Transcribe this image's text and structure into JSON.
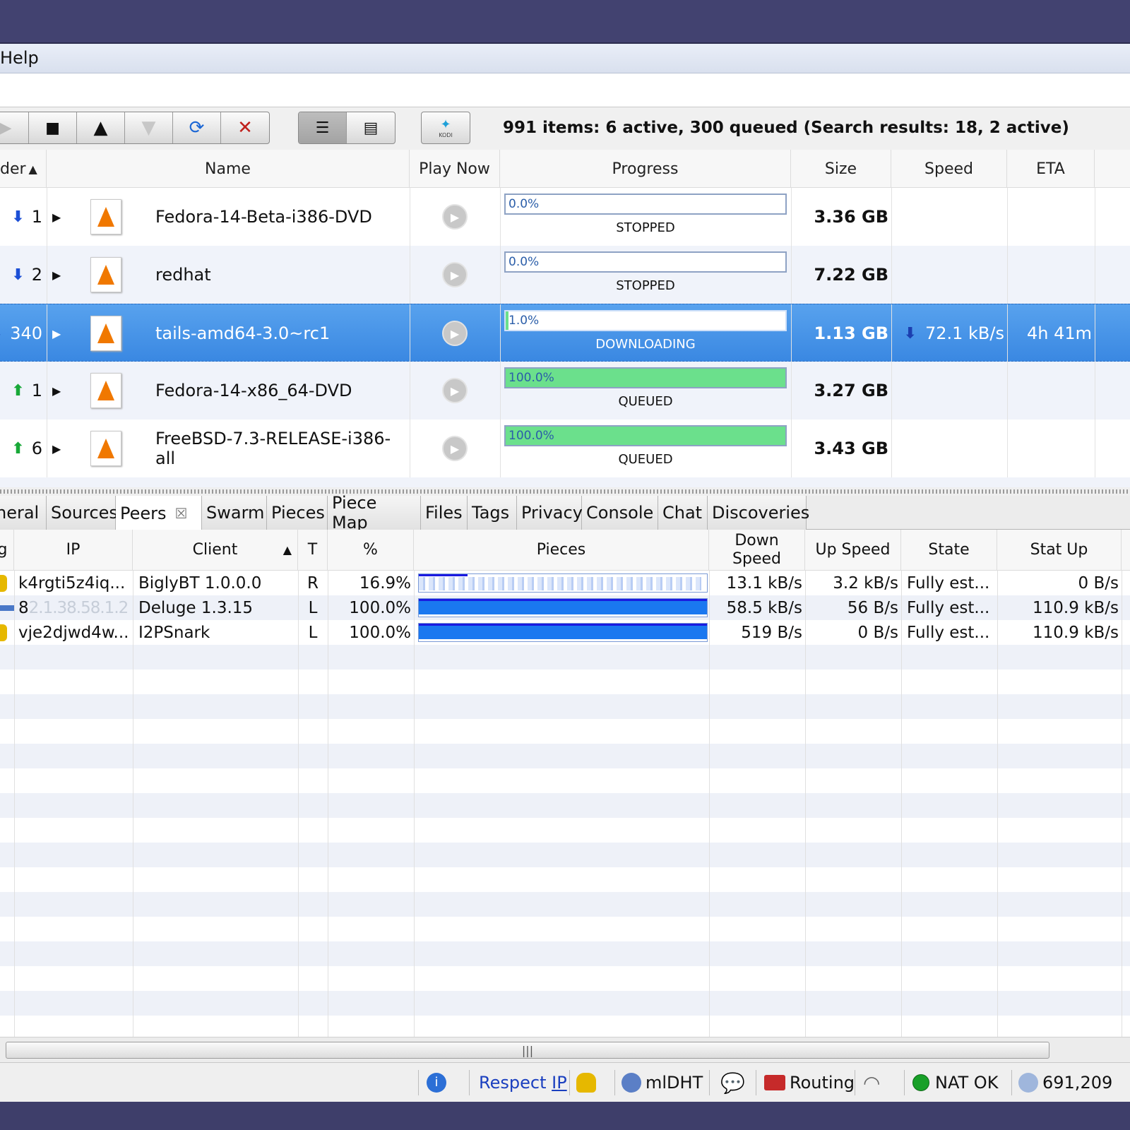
{
  "menubar": {
    "help": "Help"
  },
  "toolbar": {
    "summary": "991 items: 6 active, 300 queued (Search results: 18, 2 active)",
    "kodi_label": "KODI"
  },
  "torrent_table": {
    "columns": [
      "der",
      "Name",
      "Play Now",
      "Progress",
      "Size",
      "Speed",
      "ETA"
    ],
    "rows": [
      {
        "order": "1",
        "direction": "down",
        "name": "Fedora-14-Beta-i386-DVD",
        "progress": "0.0%",
        "progress_value": 0.0,
        "status": "STOPPED",
        "size": "3.36 GB",
        "speed": "",
        "eta": ""
      },
      {
        "order": "2",
        "direction": "down",
        "name": "redhat",
        "progress": "0.0%",
        "progress_value": 0.0,
        "status": "STOPPED",
        "size": "7.22 GB",
        "speed": "",
        "eta": ""
      },
      {
        "order": "340",
        "direction": "down",
        "name": "tails-amd64-3.0~rc1",
        "progress": "1.0%",
        "progress_value": 1.0,
        "status": "DOWNLOADING",
        "size": "1.13 GB",
        "speed": "72.1 kB/s",
        "eta": "4h 41m",
        "selected": true
      },
      {
        "order": "1",
        "direction": "up",
        "name": "Fedora-14-x86_64-DVD",
        "progress": "100.0%",
        "progress_value": 100.0,
        "status": "QUEUED",
        "size": "3.27 GB",
        "speed": "",
        "eta": ""
      },
      {
        "order": "6",
        "direction": "up",
        "name": "FreeBSD-7.3-RELEASE-i386-all",
        "progress": "100.0%",
        "progress_value": 100.0,
        "status": "QUEUED",
        "size": "3.43 GB",
        "speed": "",
        "eta": ""
      }
    ]
  },
  "tabs": [
    "neral",
    "Sources",
    "Peers",
    "Swarm",
    "Pieces",
    "Piece Map",
    "Files",
    "Tags",
    "Privacy",
    "Console",
    "Chat",
    "Discoveries"
  ],
  "peers_table": {
    "columns": {
      "g": "g",
      "ip": "IP",
      "client": "Client",
      "t": "T",
      "pct": "%",
      "pieces": "Pieces",
      "down_speed": "Down Speed",
      "up_speed": "Up Speed",
      "state": "State",
      "stat_up": "Stat Up"
    },
    "rows": [
      {
        "ip": "k4rgti5z4iq...",
        "ip_masked": "",
        "client": "BiglyBT 1.0.0.0",
        "t": "R",
        "pct": "16.9%",
        "pct_value": 16.9,
        "down_speed": "13.1 kB/s",
        "up_speed": "3.2 kB/s",
        "state": "Fully est...",
        "stat_up": "0 B/s"
      },
      {
        "ip": "8",
        "ip_masked": "2.1.38.58.1.2",
        "client": "Deluge 1.3.15",
        "t": "L",
        "pct": "100.0%",
        "pct_value": 100.0,
        "down_speed": "58.5 kB/s",
        "up_speed": "56 B/s",
        "state": "Fully est...",
        "stat_up": "110.9 kB/s"
      },
      {
        "ip": "vje2djwd4w...",
        "ip_masked": "",
        "client": "I2PSnark",
        "t": "L",
        "pct": "100.0%",
        "pct_value": 100.0,
        "down_speed": "519 B/s",
        "up_speed": "0 B/s",
        "state": "Fully est...",
        "stat_up": "110.9 kB/s"
      }
    ]
  },
  "statusbar": {
    "respect": "Respect",
    "ip": "IP",
    "mldht": "mlDHT",
    "routing": "Routing",
    "nat": "NAT OK",
    "count": "691,209"
  },
  "colors": {
    "accent": "#3a88e2",
    "complete": "#6be08c",
    "frame": "#424270"
  }
}
